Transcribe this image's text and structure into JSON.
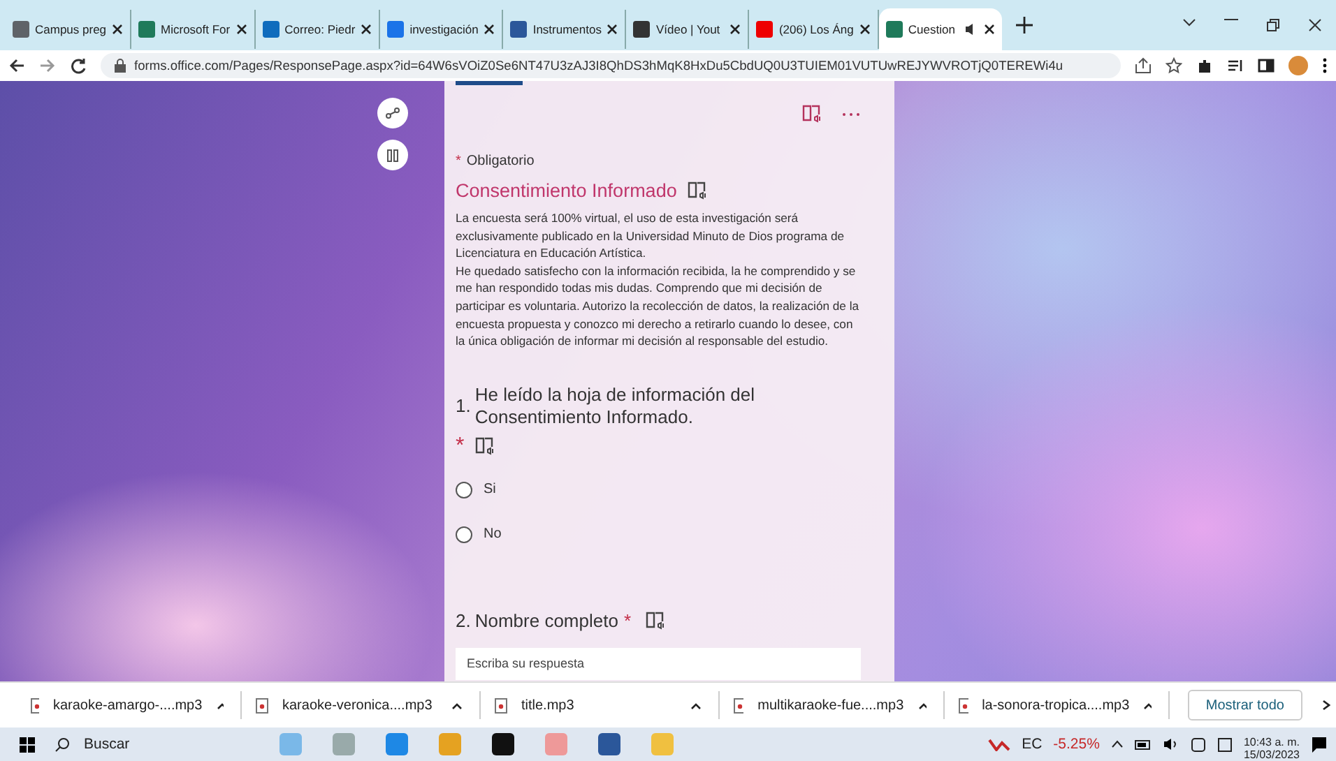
{
  "browser": {
    "tabs": [
      {
        "label": "Campus preg",
        "selected": false
      },
      {
        "label": "Microsoft For",
        "selected": false
      },
      {
        "label": "Correo: Piedr",
        "selected": false
      },
      {
        "label": "investigación",
        "selected": false
      },
      {
        "label": "Instrumentos",
        "selected": false
      },
      {
        "label": "Vídeo | Yout",
        "selected": false
      },
      {
        "label": "(206) Los Áng",
        "selected": false
      },
      {
        "label": "Cuestion",
        "selected": true
      }
    ],
    "url": "forms.office.com/Pages/ResponsePage.aspx?id=64W6sVOiZ0Se6NT47U3zAJ3I8QhDS3hMqK8HxDu5CbdUQ0U3TUIEM01VUTUwREJYWVROTjQ0TEREWi4u"
  },
  "form": {
    "required_mark": "*",
    "required_note": "Obligatorio",
    "section_title": "Consentimiento Informado",
    "description": [
      "La encuesta será 100% virtual, el uso de esta investigación será exclusivamente publicado en la Universidad Minuto de Dios programa de Licenciatura en Educación Artística.",
      "He quedado satisfecho con la información recibida, la he comprendido y se me han respondido todas mis dudas. Comprendo que mi decisión de participar es voluntaria. Autorizo la recolección de datos, la realización de la encuesta propuesta y conozco mi derecho a retirarlo cuando lo desee, con la única obligación de informar mi decisión al responsable del estudio."
    ],
    "questions": [
      {
        "kind": "choice",
        "number": "1.",
        "title": "He leído la hoja de información del Consentimiento Informado.",
        "required": true,
        "options": [
          {
            "label": "Si",
            "selected": false
          },
          {
            "label": "No",
            "selected": false
          }
        ]
      },
      {
        "kind": "text",
        "number": "2.",
        "title": "Nombre completo",
        "required": true,
        "placeholder": "Escriba su respuesta"
      }
    ]
  },
  "downloads": {
    "items": [
      "karaoke-amargo-....mp3",
      "karaoke-veronica....mp3",
      "title.mp3",
      "multikaraoke-fue....mp3",
      "la-sonora-tropica....mp3"
    ],
    "show_all": "Mostrar todo"
  },
  "taskbar": {
    "search_placeholder": "Buscar",
    "ticker": "EC",
    "change": "-5.25%",
    "time": "10:43 a. m.",
    "date": "15/03/2023"
  }
}
